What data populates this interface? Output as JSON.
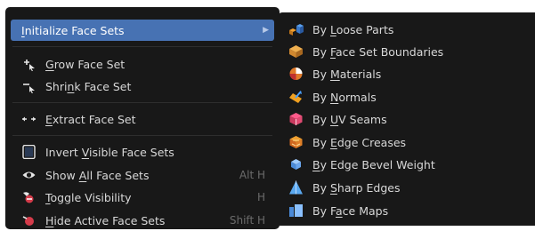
{
  "main_menu": {
    "items": [
      {
        "label": "Initialize Face Sets",
        "underline": "I",
        "icon": "none",
        "highlighted": true,
        "submenu_arrow": "▶"
      },
      {
        "label": "Grow Face Set",
        "underline": "G",
        "icon": "grow-arrow-icon"
      },
      {
        "label": "Shrink Face Set",
        "underline": "n",
        "icon": "shrink-arrow-icon"
      },
      {
        "label": "Extract Face Set",
        "underline": "E",
        "icon": "extract-arrows-icon"
      },
      {
        "label": "Invert Visible Face Sets",
        "underline": "V",
        "icon": "invert-frame-icon"
      },
      {
        "label": "Show All Face Sets",
        "underline": "A",
        "icon": "eye-icon",
        "shortcut": "Alt H"
      },
      {
        "label": "Toggle Visibility",
        "underline": "T",
        "icon": "toggle-hide-icon",
        "shortcut": "H"
      },
      {
        "label": "Hide Active Face Sets",
        "underline": "H",
        "icon": "hide-active-icon",
        "shortcut": "Shift H"
      }
    ]
  },
  "sub_menu": {
    "items": [
      {
        "label": "By Loose Parts",
        "underline": "L",
        "icon": "loose-parts-icon"
      },
      {
        "label": "By Face Set Boundaries",
        "underline": "F",
        "icon": "face-set-boundaries-icon"
      },
      {
        "label": "By Materials",
        "underline": "M",
        "icon": "materials-icon"
      },
      {
        "label": "By Normals",
        "underline": "N",
        "icon": "normals-icon"
      },
      {
        "label": "By UV Seams",
        "underline": "U",
        "icon": "uv-seams-icon"
      },
      {
        "label": "By Edge Creases",
        "underline": "E",
        "icon": "edge-creases-icon"
      },
      {
        "label": "By Edge Bevel Weight",
        "underline": "B",
        "icon": "edge-bevel-weight-icon"
      },
      {
        "label": "By Sharp Edges",
        "underline": "S",
        "icon": "sharp-edges-icon"
      },
      {
        "label": "By Face Maps",
        "underline": "a",
        "icon": "face-maps-icon"
      }
    ]
  },
  "colors": {
    "menu_background": "#181818",
    "highlight": "#4772b3",
    "text": "#d8d8d8",
    "shortcut_text": "#6b6b6b"
  }
}
